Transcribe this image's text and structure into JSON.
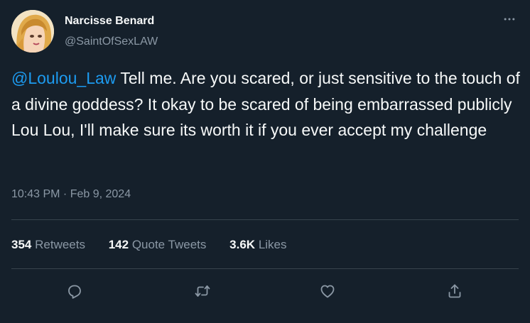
{
  "author": {
    "display_name": "Narcisse Benard",
    "handle": "@SaintOfSexLAW"
  },
  "tweet": {
    "mention": "@Loulou_Law",
    "body": " Tell me. Are you scared, or just sensitive to the touch of a divine goddess? It okay to be scared of being embarrassed publicly Lou Lou, I'll make sure its worth it if you ever accept my challenge",
    "time": "10:43 PM",
    "separator": " · ",
    "date": "Feb 9, 2024"
  },
  "stats": {
    "retweets": {
      "count": "354",
      "label": "Retweets"
    },
    "quote_tweets": {
      "count": "142",
      "label": "Quote Tweets"
    },
    "likes": {
      "count": "3.6K",
      "label": "Likes"
    }
  },
  "icons": {
    "more": "more-horizontal-icon",
    "reply": "reply-icon",
    "retweet": "retweet-icon",
    "like": "heart-icon",
    "share": "share-icon"
  },
  "colors": {
    "background": "#15202b",
    "text": "#f7f9f9",
    "secondary": "#8b98a5",
    "accent": "#1d9bf0",
    "divider": "#38444d"
  }
}
